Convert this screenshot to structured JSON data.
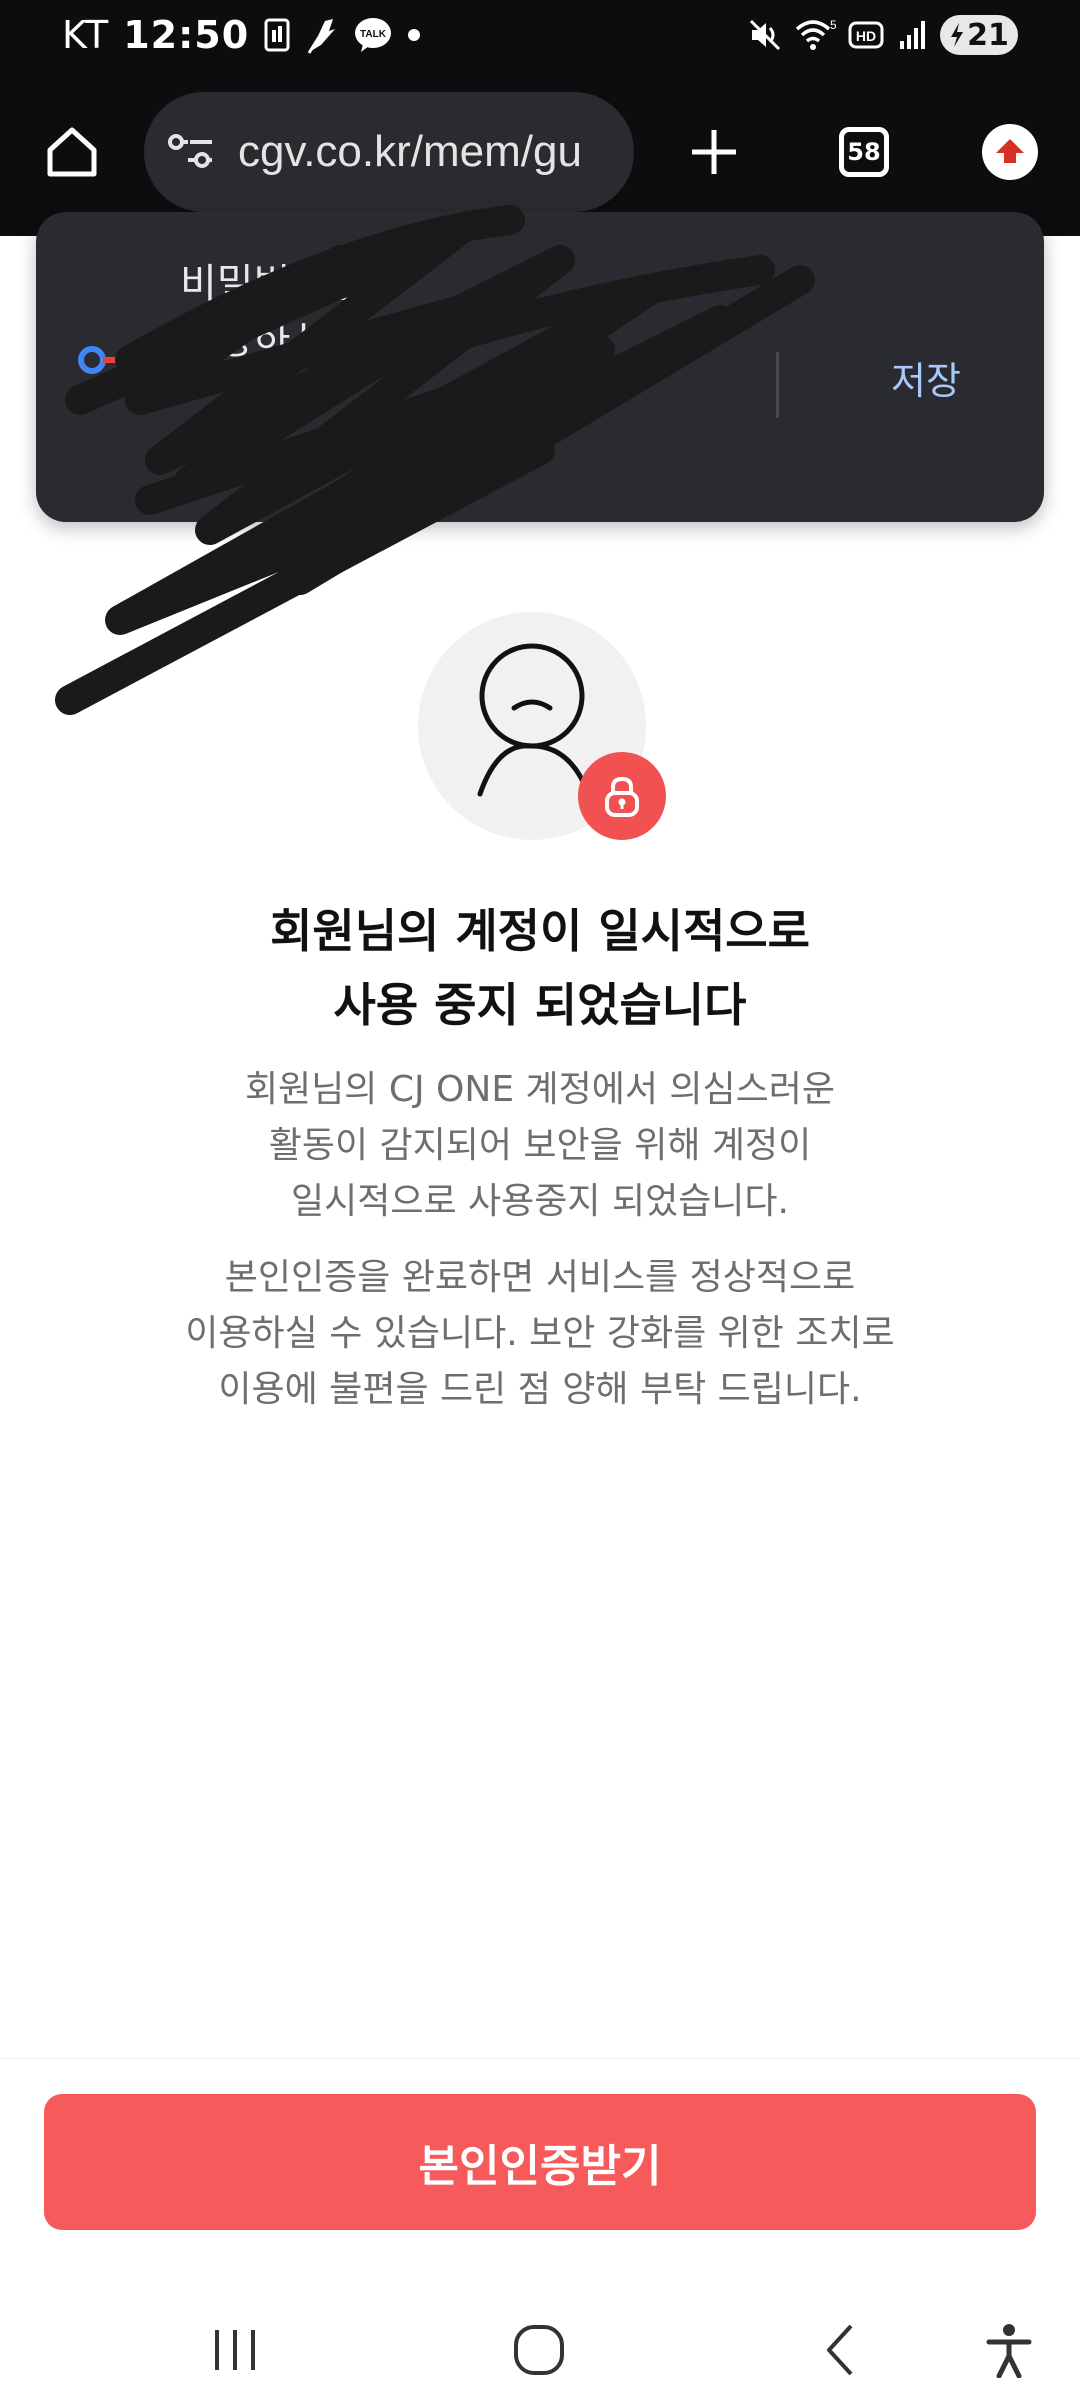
{
  "status_bar": {
    "carrier": "KT",
    "time": "12:50",
    "battery_level": "21",
    "notification_icons": [
      "sim-card-icon",
      "feather-app-icon",
      "talk-icon",
      "dot-icon"
    ],
    "talk_label": "TALK",
    "system_icons": [
      "mute-icon",
      "wifi-icon",
      "hd-icon",
      "signal-icon",
      "battery-charging-icon"
    ],
    "wifi_label": "5",
    "hd_label": "HD"
  },
  "browser": {
    "url": "cgv.co.kr/mem/gu",
    "tab_count": "58"
  },
  "password_popup": {
    "title_line1": "비밀번호를",
    "title_line2": "저장하시",
    "save_label": "저장",
    "key_icon_colors": [
      "#4285f4",
      "#ea4335",
      "#fbbc04",
      "#34a853"
    ]
  },
  "notice": {
    "headline_line1": "회원님의 계정이 일시적으로",
    "headline_line2": "사용 중지 되었습니다",
    "desc1_line1": "회원님의 CJ ONE 계정에서 의심스러운",
    "desc1_line2": "활동이 감지되어 보안을 위해 계정이",
    "desc1_line3": "일시적으로 사용중지 되었습니다.",
    "desc2_line1": "본인인증을 완료하면 서비스를 정상적으로",
    "desc2_line2": "이용하실 수 있습니다. 보안 강화를 위한 조치로",
    "desc2_line3": "이용에 불편을 드린 점 양해 부탁 드립니다."
  },
  "primary_button": {
    "label": "본인인증받기",
    "color": "#f75a5a"
  },
  "nav_bar": {
    "items": [
      "recents-icon",
      "home-icon",
      "back-icon",
      "accessibility-icon"
    ]
  },
  "colors": {
    "accent": "#f25151",
    "toolbar_bg": "#0d0d0f",
    "popup_bg": "#2a2b30",
    "popup_action": "#a8c7fa"
  }
}
